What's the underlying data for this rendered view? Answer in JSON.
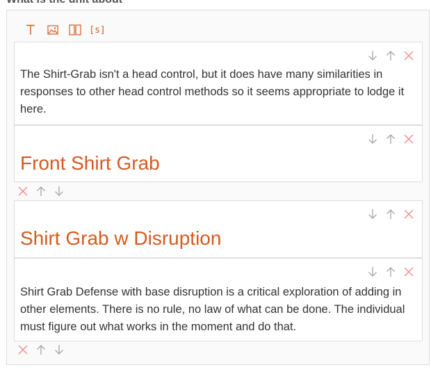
{
  "section": {
    "label": "What is the unit about"
  },
  "toolbar": {
    "items": [
      {
        "name": "text",
        "icon": "text-t-icon"
      },
      {
        "name": "image",
        "icon": "image-icon"
      },
      {
        "name": "columns",
        "icon": "columns-icon"
      },
      {
        "name": "shortcode",
        "icon": "shortcode-icon",
        "label": "[s]"
      }
    ]
  },
  "blocks": [
    {
      "type": "paragraph",
      "text": "The Shirt-Grab isn't a head control, but it does have many similarities in responses to other head control methods so it seems appropriate to lodge it here."
    },
    {
      "type": "heading",
      "text": "Front Shirt Grab"
    },
    {
      "type": "heading",
      "text": "Shirt Grab w Disruption"
    },
    {
      "type": "paragraph",
      "text": "Shirt Grab Defense with base disruption is a critical exploration of adding in other elements. There is no rule, no law of what can be done. The individual must figure out what works in the moment and do that."
    }
  ],
  "colors": {
    "accent": "#d65a1f",
    "delete": "#f08f8f",
    "arrow": "#aaaaaa",
    "border": "#dddddd"
  }
}
